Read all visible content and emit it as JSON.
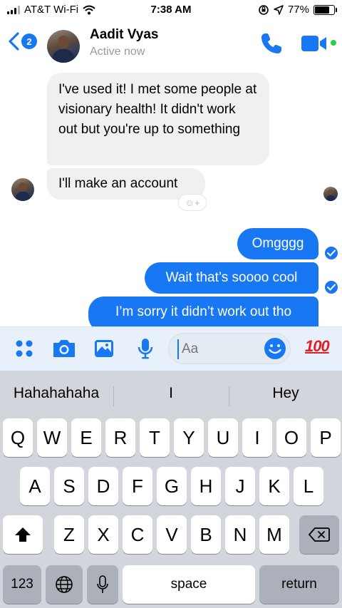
{
  "status_bar": {
    "carrier": "AT&T Wi-Fi",
    "time": "7:38 AM",
    "battery": "77%",
    "battery_level": 0.77
  },
  "header": {
    "back_badge": "2",
    "contact_name": "Aadit Vyas",
    "contact_status": "Active now",
    "icons": [
      "back-chevron-icon",
      "phone-icon",
      "video-camera-icon"
    ]
  },
  "messages": {
    "incoming": [
      "I've used it! I met some people at visionary health! It didn't work out but you're up to something",
      "I'll make an account"
    ],
    "outgoing": [
      "Omgggg",
      "Wait that’s soooo cool",
      "I’m sorry it didn’t work out tho"
    ],
    "reaction_pill": "☺+"
  },
  "composer": {
    "placeholder": "Aa",
    "tools": [
      "more-icon",
      "camera-icon",
      "image-icon",
      "microphone-icon",
      "emoji-icon"
    ],
    "hundred_label": "100"
  },
  "keyboard": {
    "predictions": [
      "Hahahahaha",
      "I",
      "Hey"
    ],
    "row1": [
      "Q",
      "W",
      "E",
      "R",
      "T",
      "Y",
      "U",
      "I",
      "O",
      "P"
    ],
    "row2": [
      "A",
      "S",
      "D",
      "F",
      "G",
      "H",
      "J",
      "K",
      "L"
    ],
    "row3": [
      "Z",
      "X",
      "C",
      "V",
      "B",
      "N",
      "M"
    ],
    "numbers_label": "123",
    "space_label": "space",
    "return_label": "return"
  },
  "colors": {
    "accent": "#1877f2",
    "online": "#31cc46",
    "incoming_bubble": "#f0f0f0",
    "keyboard_bg": "#d2d5db"
  }
}
